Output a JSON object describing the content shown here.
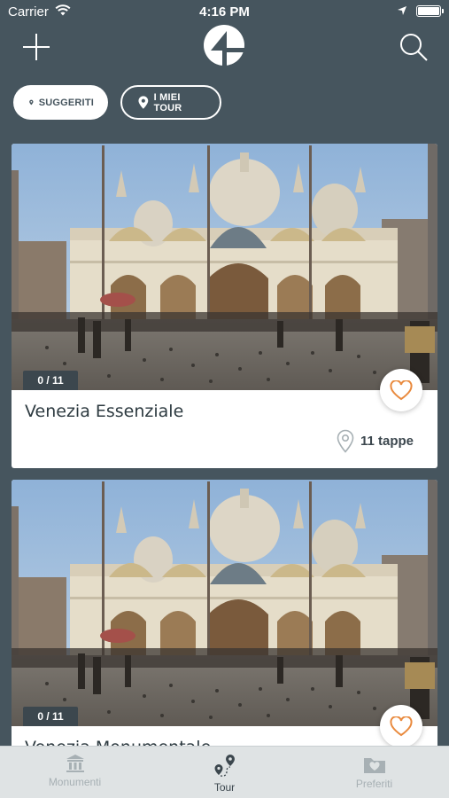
{
  "status_bar": {
    "carrier": "Carrier",
    "time": "4:16 PM"
  },
  "filters": {
    "suggested": "SUGGERITI",
    "my_tours": "I MIEI TOUR"
  },
  "tours": [
    {
      "title": "Venezia Essenziale",
      "progress": "0 / 11",
      "stops": "11 tappe"
    },
    {
      "title": "Venezia Monumentale",
      "progress": "0 / 11"
    }
  ],
  "tabs": [
    {
      "label": "Monumenti",
      "icon": "monument-icon"
    },
    {
      "label": "Tour",
      "icon": "route-pins-icon"
    },
    {
      "label": "Preferiti",
      "icon": "heart-folder-icon"
    }
  ],
  "colors": {
    "background": "#46555e",
    "accent_heart": "#e98a3e",
    "tab_bar": "#dfe3e4"
  }
}
